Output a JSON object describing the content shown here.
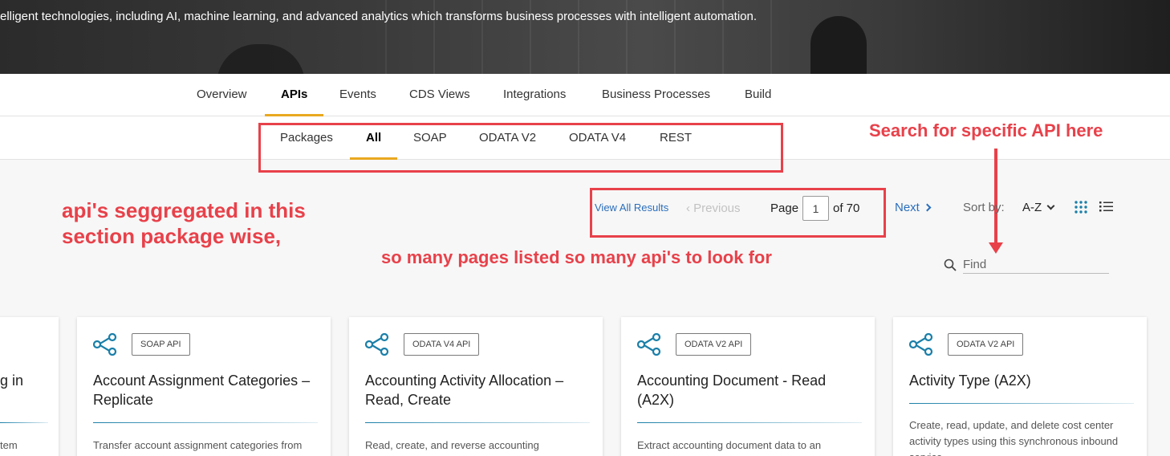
{
  "hero": {
    "text": "elligent technologies, including AI, machine learning, and advanced analytics which transforms business processes with intelligent automation."
  },
  "primary_tabs": [
    {
      "label": "Overview",
      "active": false
    },
    {
      "label": "APIs",
      "active": true
    },
    {
      "label": "Events",
      "active": false
    },
    {
      "label": "CDS Views",
      "active": false
    },
    {
      "label": "Integrations",
      "active": false
    },
    {
      "label": "Business Processes",
      "active": false
    },
    {
      "label": "Build",
      "active": false
    }
  ],
  "secondary_tabs": [
    {
      "label": "Packages",
      "active": false
    },
    {
      "label": "All",
      "active": true
    },
    {
      "label": "SOAP",
      "active": false
    },
    {
      "label": "ODATA V2",
      "active": false
    },
    {
      "label": "ODATA V4",
      "active": false
    },
    {
      "label": "REST",
      "active": false
    }
  ],
  "toolbar": {
    "view_all": "View All Results",
    "previous": "‹ Previous",
    "page_label": "Page",
    "page_value": "1",
    "of_label": "of 70",
    "next": "Next",
    "sort_label": "Sort by:",
    "sort_value": "A-Z",
    "find_placeholder": "Find"
  },
  "annotations": {
    "search": "Search for specific API here",
    "segregated_line1": "api's seggregated in this",
    "segregated_line2": "section package wise,",
    "pages": "so many pages listed so many api's to look for",
    "color": "#e8414a"
  },
  "partial_card": {
    "title": "g in",
    "desc": "tem"
  },
  "cards": [
    {
      "badge": "SOAP API",
      "title": "Account Assignment Categories – Replicate",
      "desc": "Transfer account assignment categories from"
    },
    {
      "badge": "ODATA V4 API",
      "title": "Accounting Activity Allocation – Read, Create",
      "desc": "Read, create, and reverse accounting"
    },
    {
      "badge": "ODATA V2 API",
      "title": "Accounting Document - Read (A2X)",
      "desc": "Extract accounting document data to an"
    },
    {
      "badge": "ODATA V2 API",
      "title": "Activity Type (A2X)",
      "desc": "Create, read, update, and delete cost center activity types using this synchronous inbound service."
    }
  ],
  "colors": {
    "accent": "#e9a820",
    "link": "#2a6ebb",
    "icon": "#1a7fa8"
  }
}
